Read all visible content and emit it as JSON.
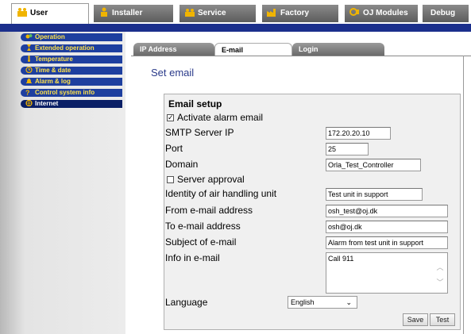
{
  "top_tabs": [
    {
      "label": "User",
      "active": true,
      "icon": "users-icon"
    },
    {
      "label": "Installer",
      "active": false,
      "icon": "installer-icon"
    },
    {
      "label": "Service",
      "active": false,
      "icon": "service-icon"
    },
    {
      "label": "Factory",
      "active": false,
      "icon": "factory-icon"
    },
    {
      "label": "OJ Modules",
      "active": false,
      "icon": "modules-icon"
    },
    {
      "label": "Debug",
      "active": false,
      "icon": null
    }
  ],
  "sidebar": {
    "items": [
      {
        "label": "Operation",
        "icon": "operation-icon"
      },
      {
        "label": "Extended operation",
        "icon": "hourglass-icon"
      },
      {
        "label": "Temperature",
        "icon": "thermometer-icon"
      },
      {
        "label": "Time & date",
        "icon": "clock-icon"
      },
      {
        "label": "Alarm & log",
        "icon": "bell-icon"
      },
      {
        "label": "Control system info",
        "icon": "question-icon"
      },
      {
        "label": "Internet",
        "icon": "internet-icon",
        "active": true
      }
    ]
  },
  "sub_tabs": [
    {
      "label": "IP Address",
      "active": false
    },
    {
      "label": "E-mail",
      "active": true
    },
    {
      "label": "Login",
      "active": false
    }
  ],
  "page_title": "Set email",
  "email_setup": {
    "title": "Email setup",
    "activate_label": "Activate alarm email",
    "activate_checked": true,
    "smtp_label": "SMTP Server IP",
    "smtp_value": "172.20.20.10",
    "port_label": "Port",
    "port_value": "25",
    "domain_label": "Domain",
    "domain_value": "Orla_Test_Controller",
    "server_approval_label": "Server approval",
    "server_approval_checked": false,
    "identity_label": "Identity of air handling unit",
    "identity_value": "Test unit in support",
    "from_label": "From e-mail address",
    "from_value": "osh_test@oj.dk",
    "to_label": "To e-mail address",
    "to_value": "osh@oj.dk",
    "subject_label": "Subject of e-mail",
    "subject_value": "Alarm from test unit in support",
    "info_label": "Info in e-mail",
    "info_value": "Call 911",
    "language_label": "Language",
    "language_value": "English",
    "save_label": "Save",
    "test_label": "Test"
  },
  "colors": {
    "nav_blue": "#1b2f8c",
    "menu_text": "#ffe24a",
    "title_blue": "#2a3a8a"
  }
}
